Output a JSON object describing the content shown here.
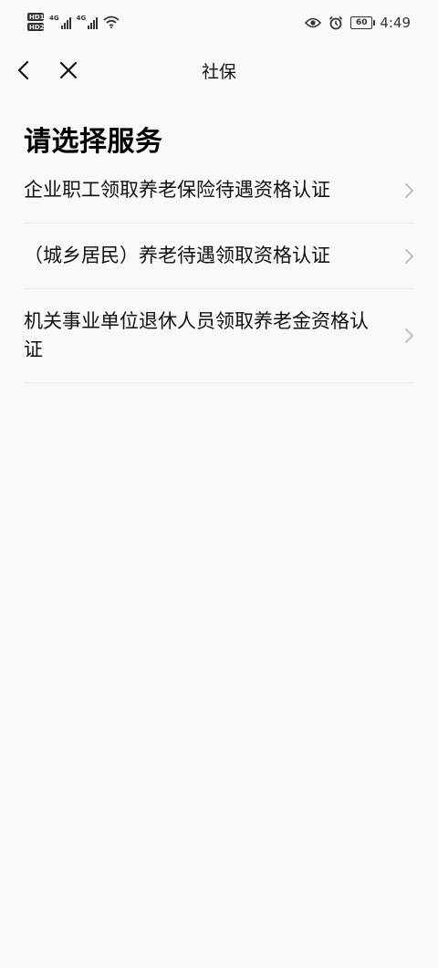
{
  "status_bar": {
    "hd_labels": [
      "HD",
      "HD"
    ],
    "sim_slot_labels": [
      "1",
      "2"
    ],
    "network_labels": [
      "4G",
      "4G"
    ],
    "battery_level": "60",
    "time": "4:49"
  },
  "nav": {
    "title": "社保"
  },
  "page": {
    "heading": "请选择服务",
    "items": [
      {
        "label": "企业职工领取养老保险待遇资格认证"
      },
      {
        "label": "（城乡居民）养老待遇领取资格认证"
      },
      {
        "label": "机关事业单位退休人员领取养老金资格认证"
      }
    ]
  },
  "colors": {
    "background": "#f9f9f9",
    "text": "#111111",
    "divider": "#ececec",
    "chevron": "#b8b8b8"
  }
}
